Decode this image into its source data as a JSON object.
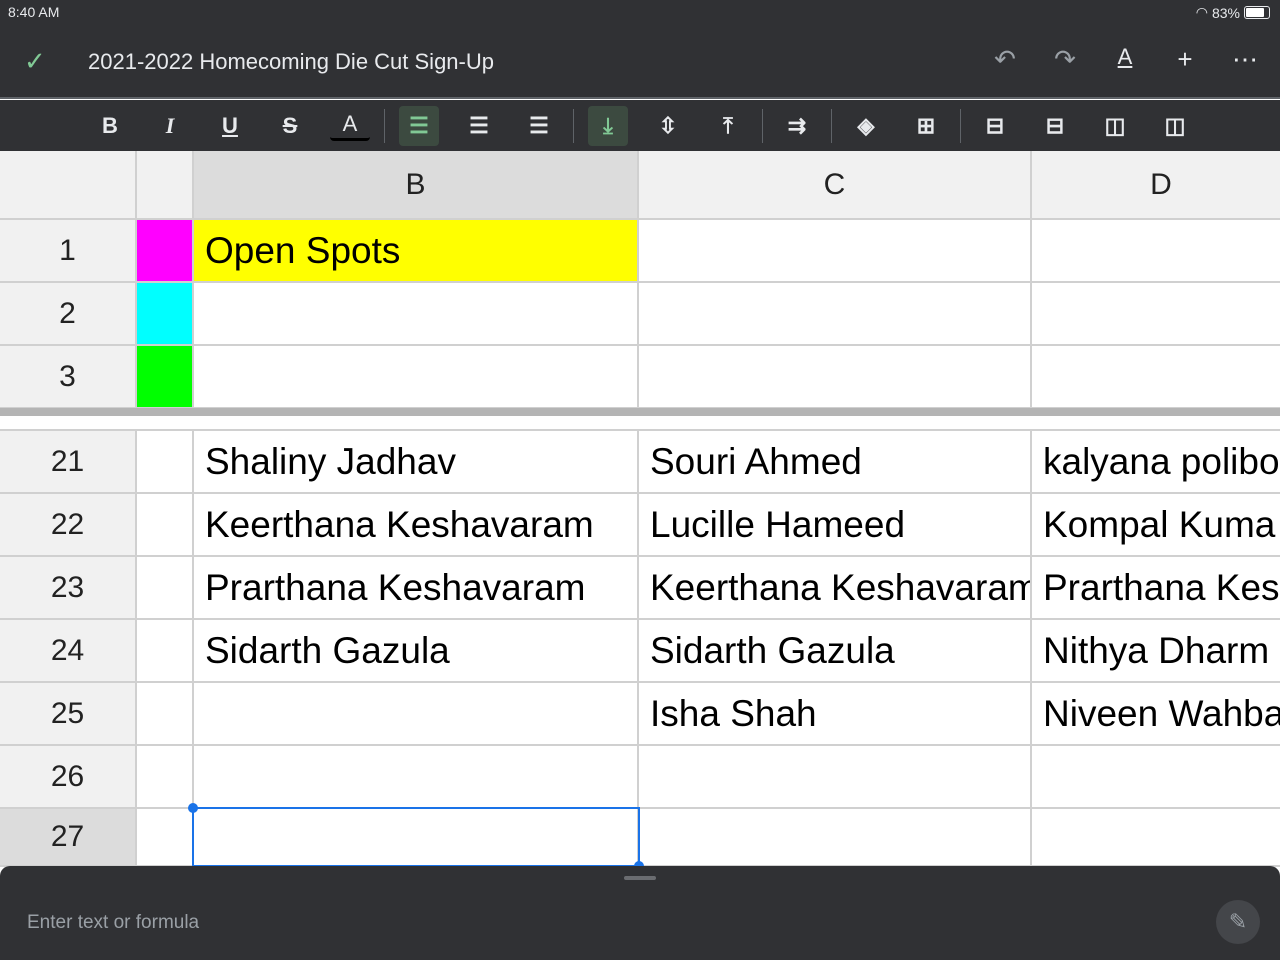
{
  "status": {
    "time": "8:40 AM",
    "battery": "83%",
    "battery_level": 0.83
  },
  "titlebar": {
    "title": "2021-2022 Homecoming Die Cut Sign-Up",
    "icons": [
      "check-icon",
      "undo-icon",
      "redo-icon",
      "text-format-icon",
      "add-icon",
      "more-icon"
    ]
  },
  "toolbar": {
    "icons": [
      "bold",
      "italic",
      "underline",
      "strikethrough",
      "text-color",
      "align-left",
      "align-center",
      "align-right",
      "valign-bottom",
      "valign-middle",
      "valign-top",
      "wrap",
      "fill-color",
      "borders",
      "insert-row-above",
      "insert-row-below",
      "insert-col-left",
      "insert-col-right"
    ],
    "labels": {
      "bold": "B",
      "italic": "I",
      "underline": "U",
      "strike": "S",
      "color": "A"
    }
  },
  "colors": {
    "accent": "#1a73e8",
    "A1": "#ff00ff",
    "A2": "#00ffff",
    "A3": "#00ff00",
    "B1": "#ffff00"
  },
  "columns": [
    "B",
    "C",
    "D"
  ],
  "rows": [
    {
      "n": "1",
      "B": "Open Spots",
      "C": "",
      "D": ""
    },
    {
      "n": "2",
      "B": "",
      "C": "",
      "D": ""
    },
    {
      "n": "3",
      "B": "",
      "C": "",
      "D": ""
    },
    {
      "n": "21",
      "B": "Shaliny Jadhav",
      "C": "Souri Ahmed",
      "D": "kalyana polibo"
    },
    {
      "n": "22",
      "B": "Keerthana Keshavaram",
      "C": "Lucille Hameed",
      "D": "Kompal Kuma"
    },
    {
      "n": "23",
      "B": "Prarthana Keshavaram",
      "C": "Keerthana Keshavaram",
      "D": "Prarthana Kes"
    },
    {
      "n": "24",
      "B": "Sidarth Gazula",
      "C": "Sidarth Gazula",
      "D": "Nithya Dharm"
    },
    {
      "n": "25",
      "B": "",
      "C": "Isha Shah",
      "D": "Niveen Wahba"
    },
    {
      "n": "26",
      "B": "",
      "C": "",
      "D": ""
    },
    {
      "n": "27",
      "B": "",
      "C": "",
      "D": ""
    }
  ],
  "formula": {
    "placeholder": "Enter text or formula"
  }
}
